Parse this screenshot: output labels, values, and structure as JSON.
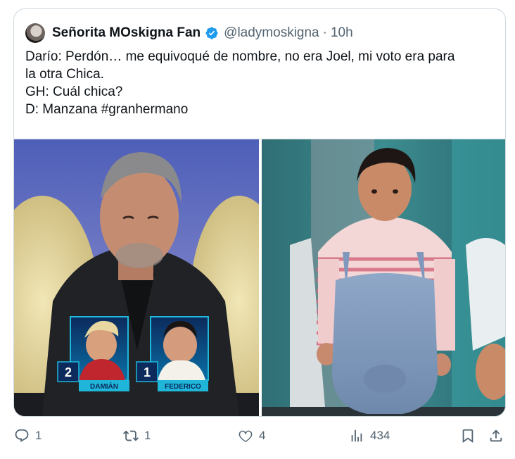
{
  "tweet": {
    "author_name": "Señorita MOskigna Fan",
    "handle": "@ladymoskigna",
    "separator": "·",
    "time": "10h",
    "lines": [
      "Darío: Perdón… me equivoqué de nombre, no era Joel, mi voto era para",
      "la otra Chica.",
      "GH: Cuál chica?",
      "D: Manzana #granhermano"
    ]
  },
  "media": {
    "left": {
      "nominees": [
        {
          "votes": "2",
          "name": "DAMIÁN"
        },
        {
          "votes": "1",
          "name": "FEDERICO"
        }
      ]
    }
  },
  "actions": {
    "replies": "1",
    "reposts": "1",
    "likes": "4",
    "views": "434"
  },
  "colors": {
    "verified": "#1d9bf0",
    "icon_gray": "#536471",
    "nominee_cyan": "#1fb6d9"
  },
  "icons": [
    "verified-badge-icon",
    "reply-icon",
    "repost-icon",
    "like-icon",
    "views-icon",
    "bookmark-icon",
    "share-icon"
  ]
}
